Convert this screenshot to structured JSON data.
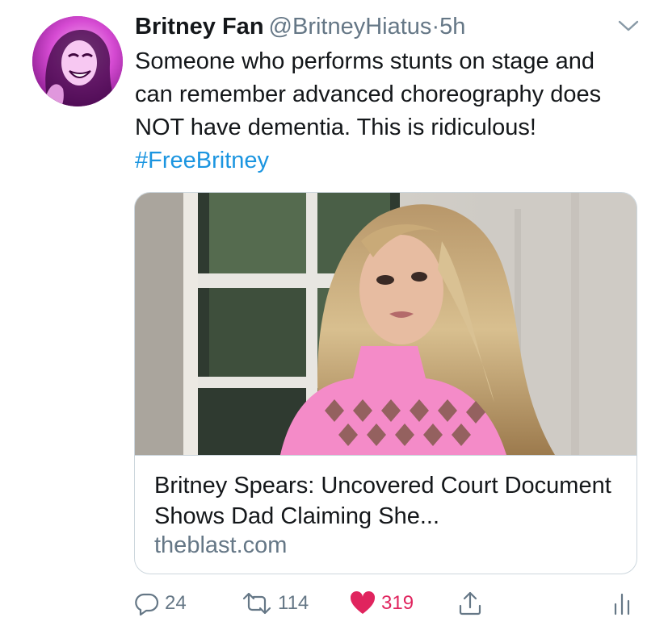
{
  "tweet": {
    "display_name": "Britney Fan",
    "handle": "@BritneyHiatus",
    "separator": "·",
    "time": "5h",
    "text_before_hashtag": "Someone who performs stunts on stage and can remember advanced choreography does NOT have dementia. This is ridiculous! ",
    "hashtag": "#FreeBritney"
  },
  "card": {
    "title": "Britney Spears: Uncovered Court Document Shows Dad Claiming She...",
    "domain": "theblast.com"
  },
  "actions": {
    "reply_count": "24",
    "retweet_count": "114",
    "like_count": "319"
  },
  "colors": {
    "link_blue": "#1b95e0",
    "secondary_gray": "#657786",
    "like_red": "#e0245e",
    "avatar_magenta": "#d23fd0",
    "dress_pink": "#f48bc8"
  },
  "icons": {
    "reply": "reply-bubble-icon",
    "retweet": "retweet-icon",
    "like": "heart-icon",
    "share": "share-icon",
    "analytics": "analytics-icon",
    "more": "chevron-down-icon"
  }
}
